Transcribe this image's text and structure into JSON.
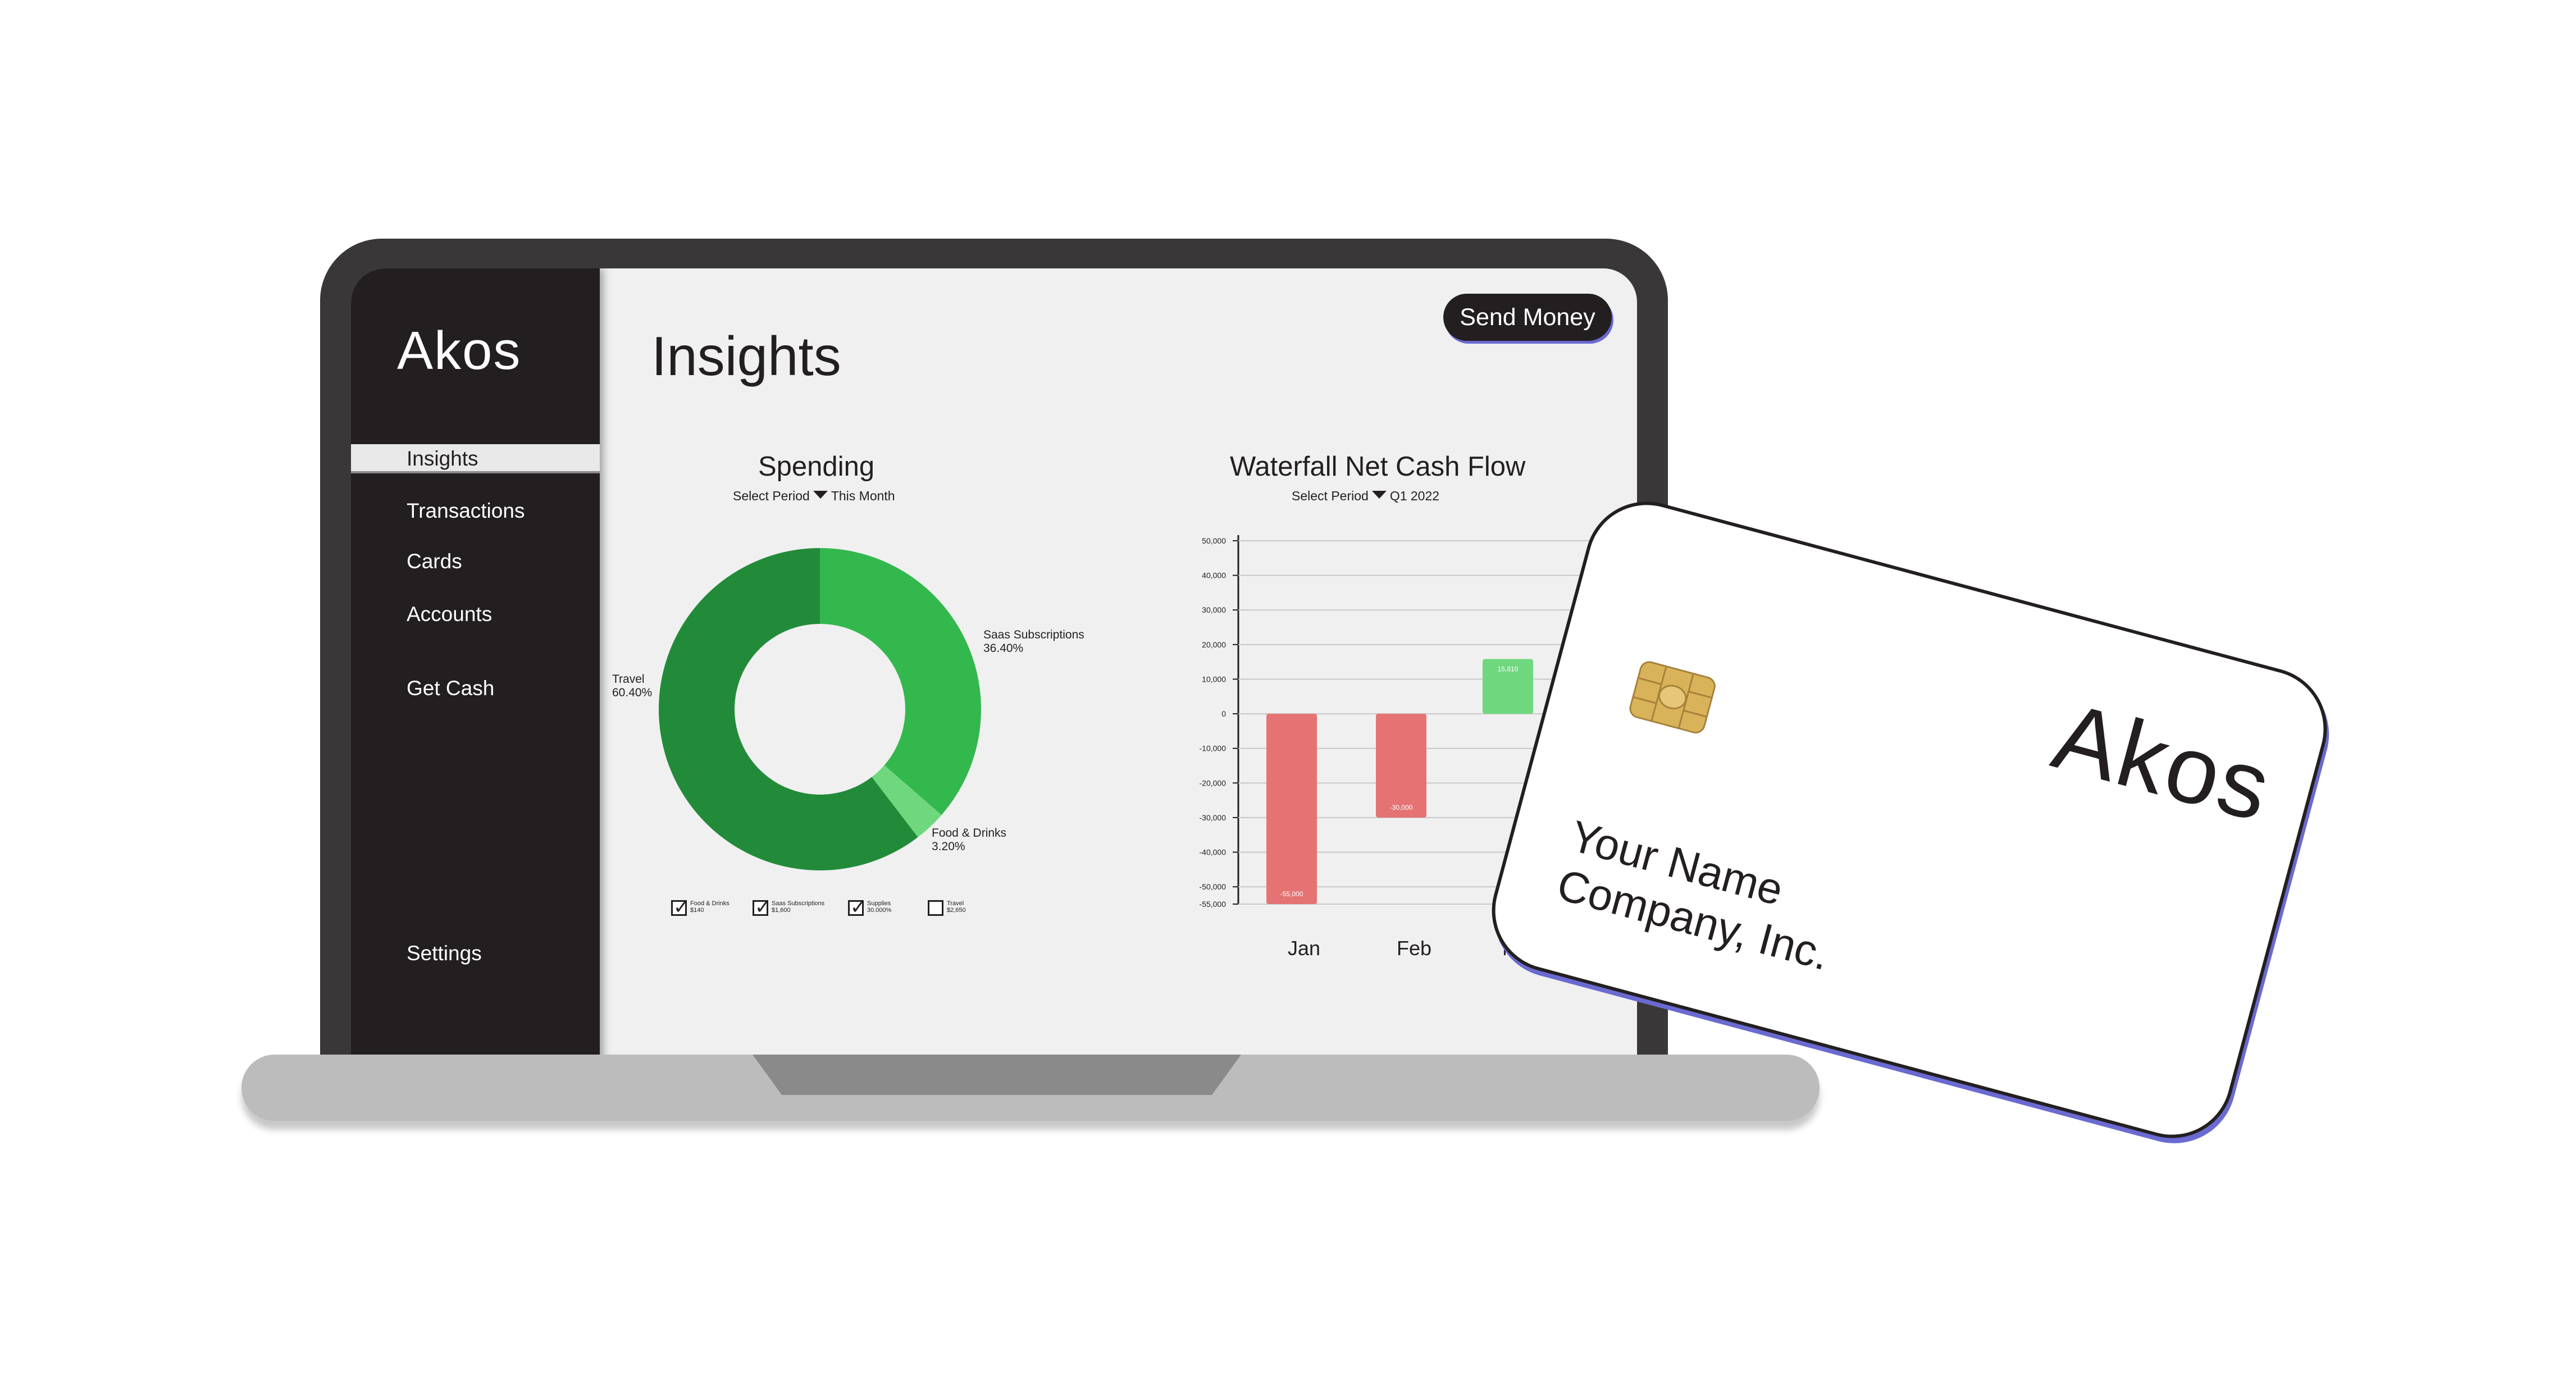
{
  "app": {
    "brand": "Akos"
  },
  "sidebar": {
    "items": [
      {
        "label": "Insights",
        "active": true
      },
      {
        "label": "Transactions"
      },
      {
        "label": "Cards"
      },
      {
        "label": "Accounts"
      },
      {
        "label": "Get Cash"
      },
      {
        "label": "Settings"
      }
    ]
  },
  "header": {
    "title": "Insights",
    "send_label": "Send Money"
  },
  "spending": {
    "title": "Spending",
    "period_label": "Select Period",
    "period_value": "This Month",
    "slices": [
      {
        "name": "Saas Subscriptions",
        "pct_text": "36.40%"
      },
      {
        "name": "Food & Drinks",
        "pct_text": "3.20%"
      },
      {
        "name": "Travel",
        "pct_text": "60.40%"
      }
    ],
    "legend": [
      {
        "line1": "Food & Drinks",
        "line2": "$140",
        "checked": true
      },
      {
        "line1": "Saas Subscriptions",
        "line2": "$1,600",
        "checked": true
      },
      {
        "line1": "Supplies",
        "line2": "30.000%",
        "checked": true
      },
      {
        "line1": "Travel",
        "line2": "$2,650",
        "checked": false
      }
    ]
  },
  "waterfall": {
    "title": "Waterfall Net Cash Flow",
    "period_label": "Select Period",
    "period_value": "Q1 2022",
    "months": [
      "Jan",
      "Feb",
      "Ma"
    ]
  },
  "card": {
    "brand": "Akos",
    "name_line1": "Your Name",
    "name_line2": "Company, Inc."
  },
  "colors": {
    "dark": "#231f20",
    "green_dark": "#228b3a",
    "green": "#33b84e",
    "green_light": "#6fd87e",
    "red": "#e57373",
    "accent_shadow": "#6a6ad0"
  },
  "chart_data": [
    {
      "type": "pie",
      "title": "Spending",
      "categories": [
        "Saas Subscriptions",
        "Food & Drinks",
        "Travel"
      ],
      "values": [
        36.4,
        3.2,
        60.4
      ]
    },
    {
      "type": "bar",
      "title": "Waterfall Net Cash Flow",
      "categories": [
        "Jan",
        "Feb",
        "Ma"
      ],
      "values": [
        -55000,
        -30000,
        15810
      ],
      "value_labels": [
        "-55,000",
        "-30,000",
        "15,810"
      ],
      "ylim": [
        -55000,
        50000
      ],
      "yticks": [
        "50,000",
        "40,000",
        "30,000",
        "20,000",
        "10,000",
        "0",
        "-10,000",
        "-20,000",
        "-30,000",
        "-40,000",
        "-50,000",
        "-55,000"
      ],
      "grid": true
    }
  ]
}
